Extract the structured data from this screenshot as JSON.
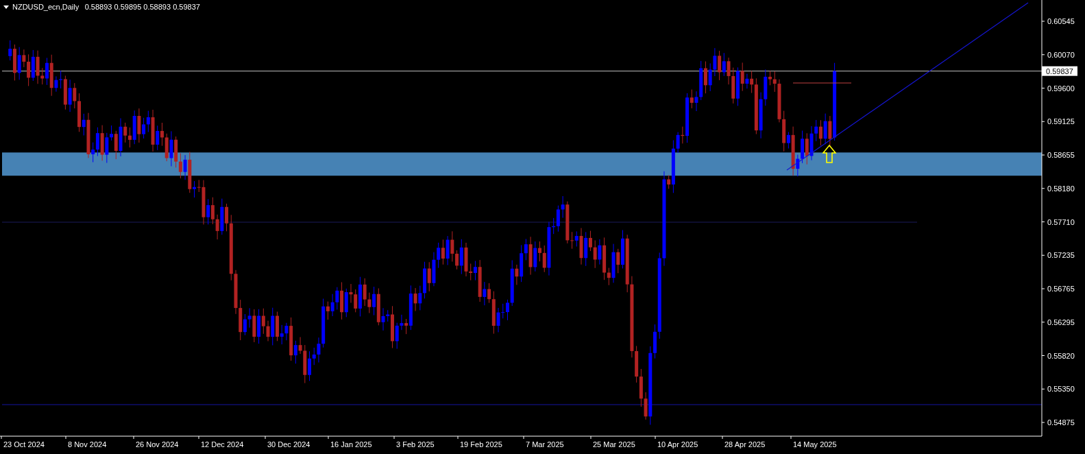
{
  "header": {
    "symbol": "NZDUSD_ecn,Daily",
    "ohlc": "0.58893 0.59895 0.58893 0.59837"
  },
  "price_axis": {
    "ticks": [
      "0.60545",
      "0.60070",
      "0.59600",
      "0.59125",
      "0.58655",
      "0.58180",
      "0.57710",
      "0.57235",
      "0.56765",
      "0.56295",
      "0.55820",
      "0.55350",
      "0.54875"
    ],
    "current_price": "0.59837"
  },
  "time_axis": {
    "labels": [
      "23 Oct 2024",
      "8 Nov 2024",
      "26 Nov 2024",
      "12 Dec 2024",
      "30 Dec 2024",
      "16 Jan 2025",
      "3 Feb 2025",
      "19 Feb 2025",
      "7 Mar 2025",
      "25 Mar 2025",
      "10 Apr 2025",
      "28 Apr 2025",
      "14 May 2025"
    ]
  }
}
